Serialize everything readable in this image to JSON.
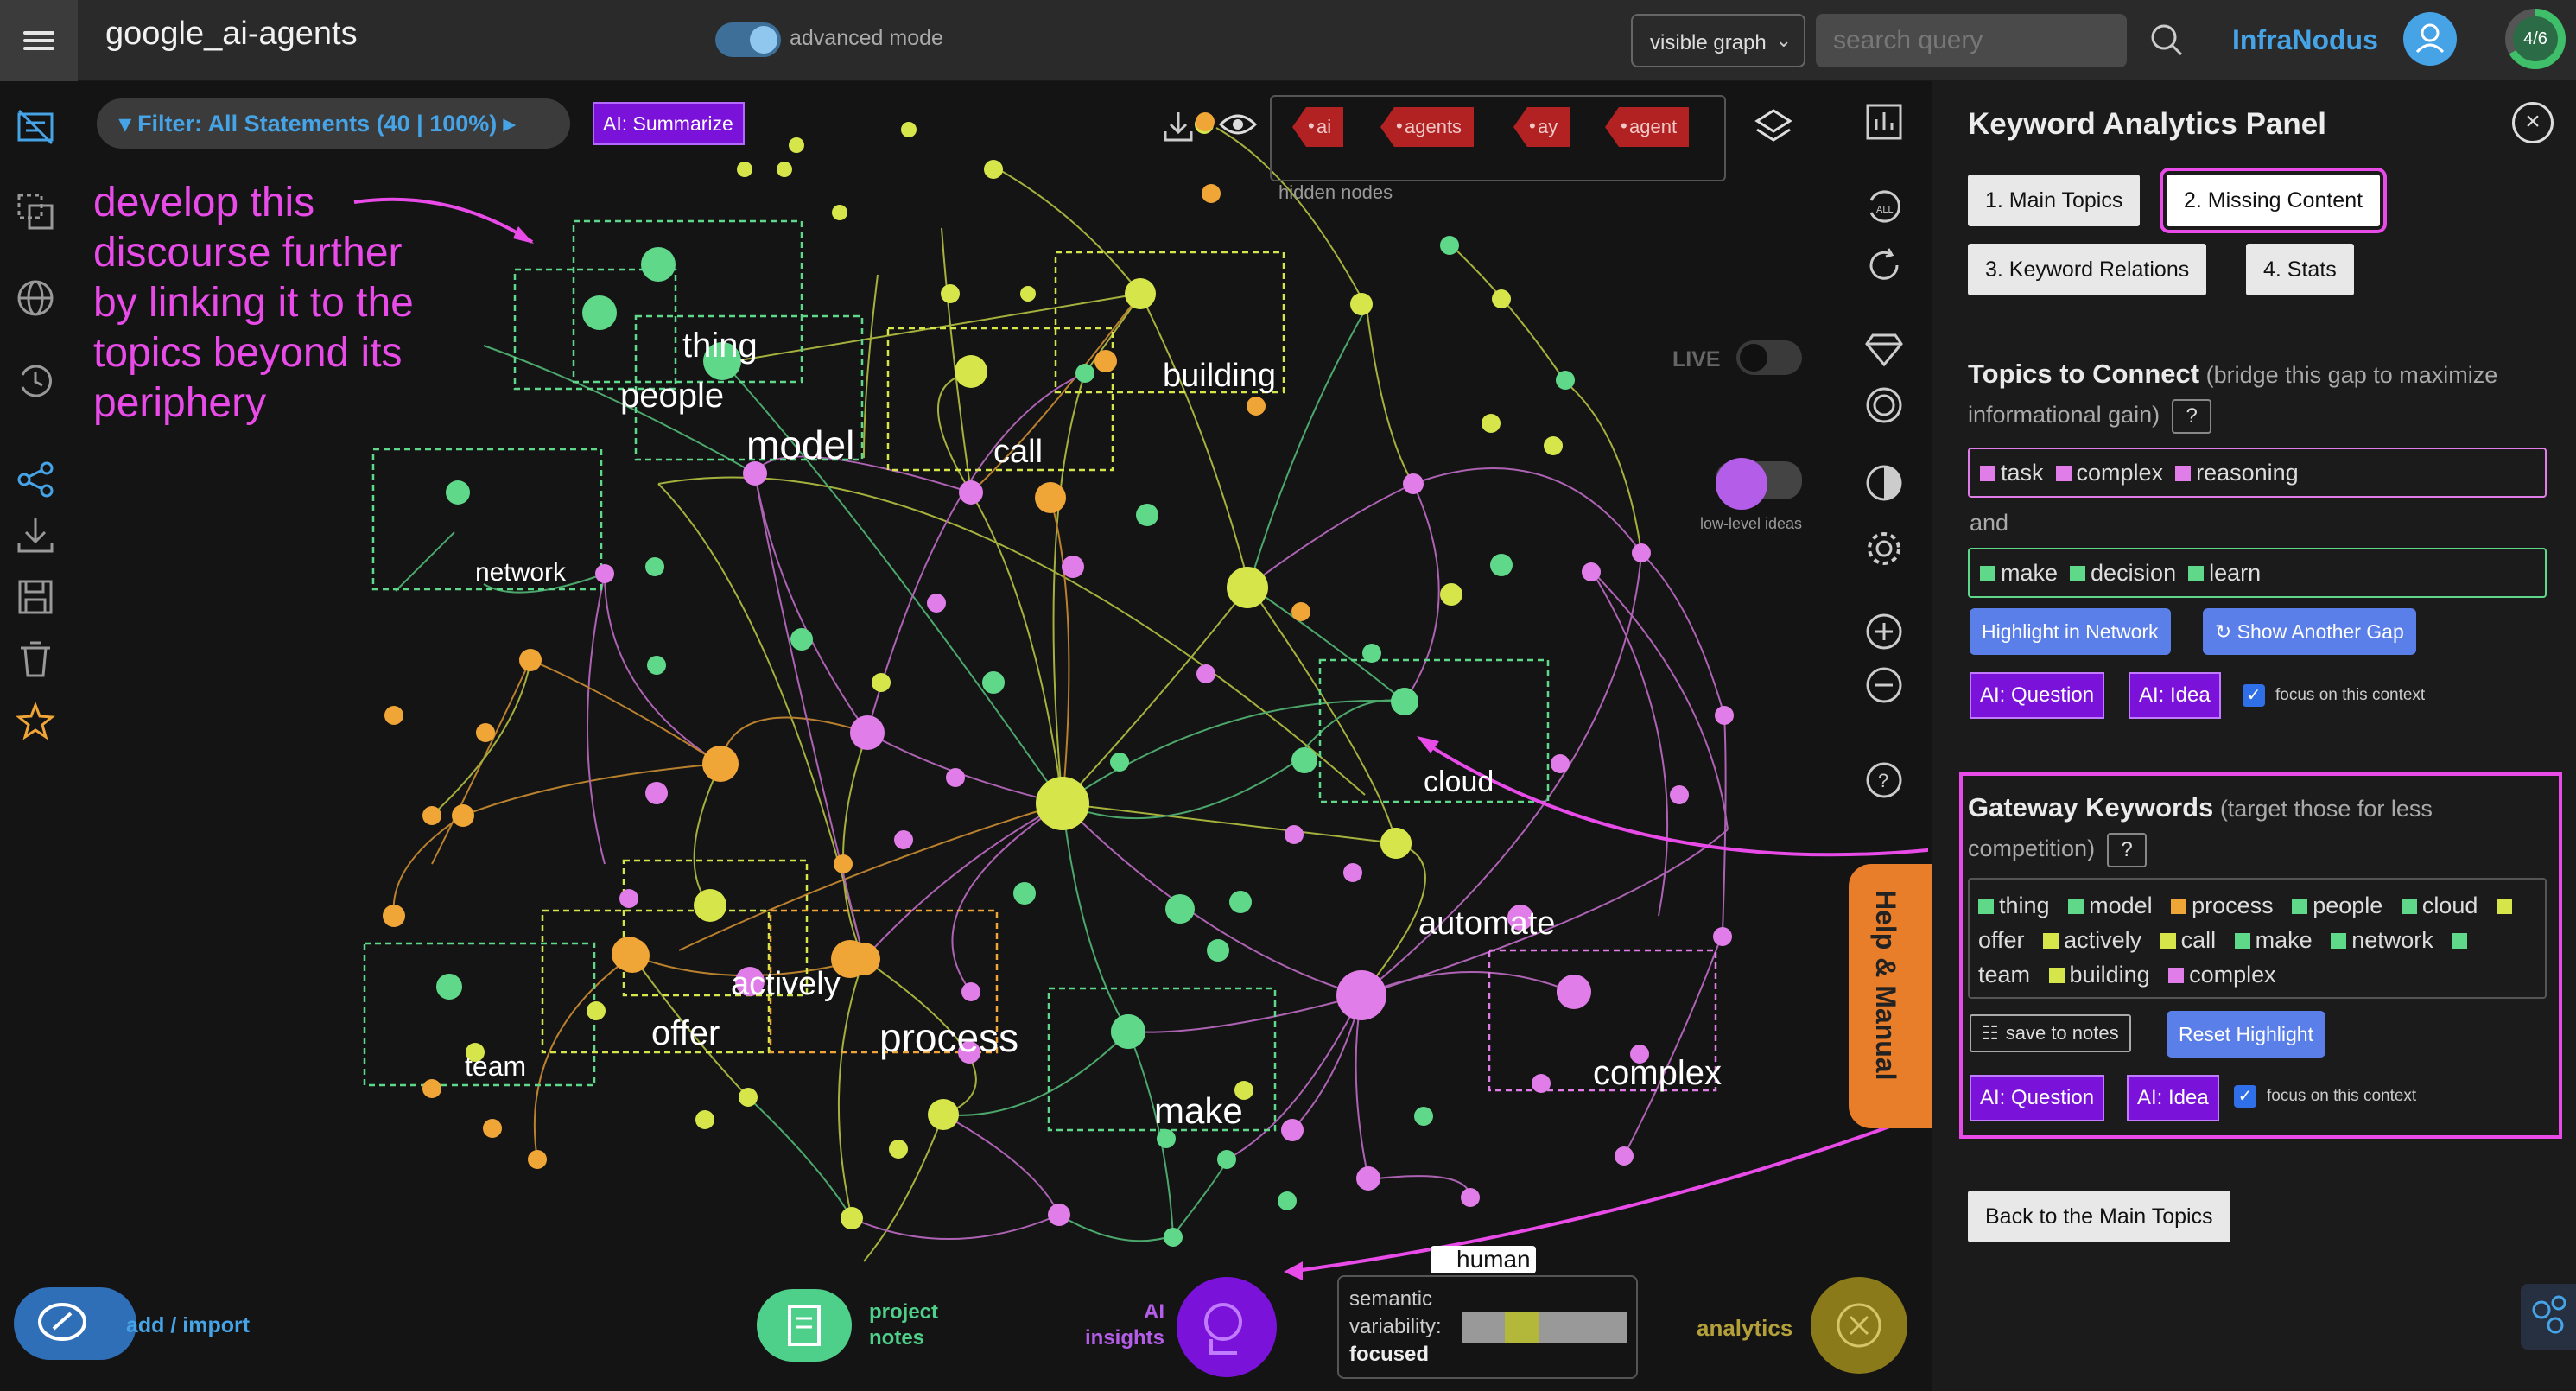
{
  "header": {
    "title": "google_ai-agents",
    "advanced_label": "advanced mode",
    "graph_select": "visible graph",
    "search_placeholder": "search query",
    "brand": "InfraNodus",
    "progress": "4/6"
  },
  "toolbar": {
    "filter_label": "Filter: All Statements (40 | 100%)",
    "summarize_label": "AI: Summarize",
    "hidden_label": "hidden nodes",
    "hidden_tags": [
      "ai",
      "agents",
      "ay",
      "agent"
    ]
  },
  "graph": {
    "annotation": "develop this discourse further by linking it to the topics beyond its periphery",
    "live_label": "LIVE",
    "lowlevel_label": "low-level ideas",
    "nodes": [
      "thing",
      "people",
      "model",
      "building",
      "call",
      "network",
      "cloud",
      "automate",
      "actively",
      "offer",
      "process",
      "team",
      "make",
      "complex",
      "human"
    ]
  },
  "help_label": "Help & Manual",
  "panel": {
    "title": "Keyword Analytics Panel",
    "tabs": [
      "1. Main Topics",
      "2. Missing Content",
      "3. Keyword Relations",
      "4. Stats"
    ],
    "topics_heading": "Topics to Connect",
    "topics_sub": "(bridge this gap to maximize informational gain)",
    "qmark": "?",
    "group1": [
      "task",
      "complex",
      "reasoning"
    ],
    "and_label": "and",
    "group2": [
      "make",
      "decision",
      "learn"
    ],
    "highlight_btn": "Highlight in Network",
    "another_gap_btn": "↻ Show Another Gap",
    "ai_question": "AI: Question",
    "ai_idea": "AI: Idea",
    "focus_label": "focus on this context",
    "gateway_heading": "Gateway Keywords",
    "gateway_sub": "(target those for less competition)",
    "gateway_keywords": [
      "thing",
      "model",
      "process",
      "people",
      "cloud",
      "offer",
      "actively",
      "call",
      "make",
      "network",
      "team",
      "building",
      "complex"
    ],
    "save_notes": "save to notes",
    "reset_highlight": "Reset Highlight",
    "back_btn": "Back to the Main Topics"
  },
  "bottom": {
    "add_label": "add / import",
    "notes_label": "project notes",
    "ai_insights_label": "AI insights",
    "sem_label_1": "semantic",
    "sem_label_2": "variability:",
    "sem_value": "focused",
    "sem_level": 0.3,
    "analytics_label": "analytics"
  },
  "colors": {
    "green": "#5fd88a",
    "yellow": "#d6e64a",
    "orange": "#f0a537",
    "pink": "#e07de8",
    "magenta": "#e84be8",
    "blue": "#45a3e6",
    "purple": "#7a12d9"
  }
}
